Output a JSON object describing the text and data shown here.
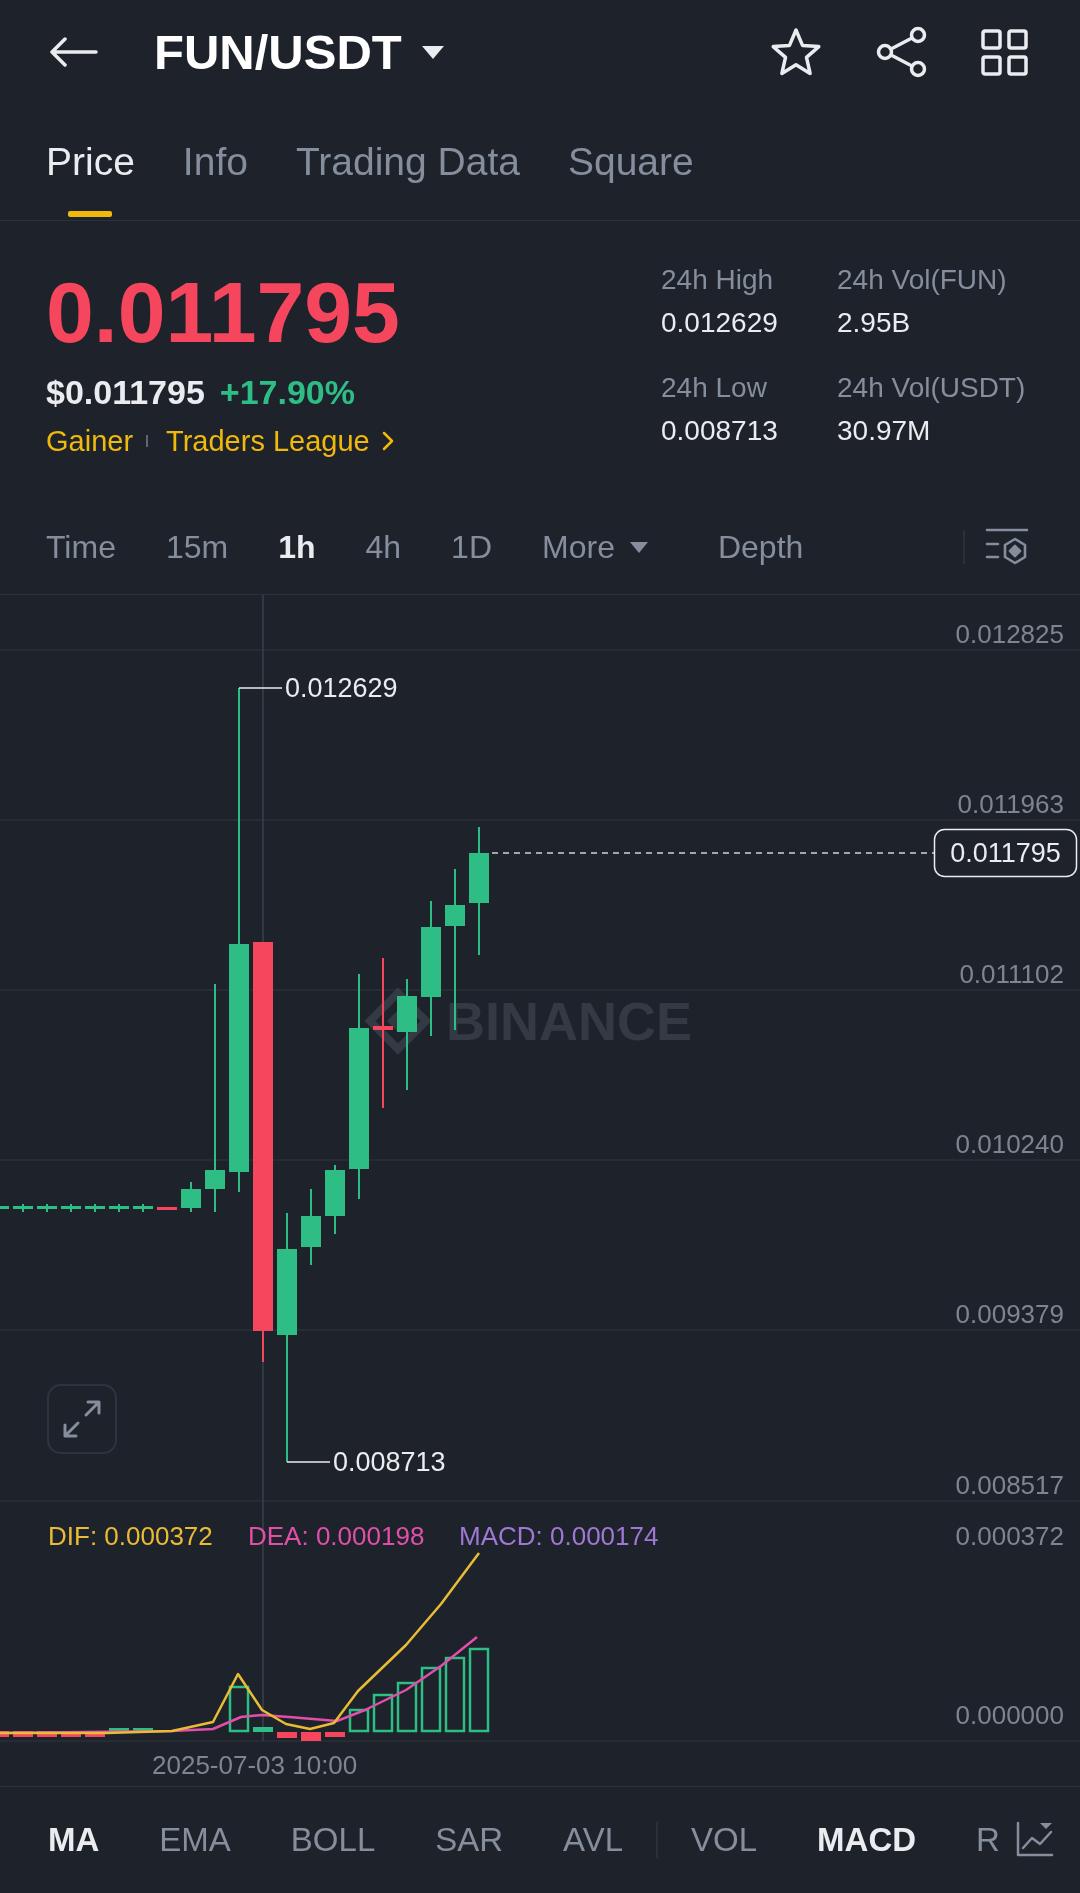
{
  "header": {
    "title": "FUN/USDT"
  },
  "tabs": [
    {
      "label": "Price",
      "selected": true
    },
    {
      "label": "Info",
      "selected": false
    },
    {
      "label": "Trading Data",
      "selected": false
    },
    {
      "label": "Square",
      "selected": false
    }
  ],
  "ticker": {
    "price": {
      "value": "0.011795",
      "rising": false
    },
    "fiat_price": "$0.011795",
    "change": {
      "value": "+17.90%",
      "rising": true
    },
    "tags": [
      {
        "label": "Gainer",
        "kind": "tag"
      },
      {
        "label": "Traders League",
        "kind": "link"
      }
    ],
    "stats": [
      {
        "label": "24h High",
        "value": "0.012629"
      },
      {
        "label": "24h Vol(FUN)",
        "value": "2.95B"
      },
      {
        "label": "24h Low",
        "value": "0.008713"
      },
      {
        "label": "24h Vol(USDT)",
        "value": "30.97M"
      }
    ]
  },
  "intervals": [
    {
      "label": "Time",
      "kind": "interval",
      "selected": false
    },
    {
      "label": "15m",
      "kind": "interval",
      "selected": false
    },
    {
      "label": "1h",
      "kind": "interval",
      "selected": true
    },
    {
      "label": "4h",
      "kind": "interval",
      "selected": false
    },
    {
      "label": "1D",
      "kind": "interval",
      "selected": false
    },
    {
      "label": "More",
      "kind": "dropdown",
      "selected": false
    },
    {
      "label": "Depth",
      "kind": "view",
      "selected": false
    }
  ],
  "chart": {
    "watermark": "BINANCE",
    "price_axis": [
      "0.012825",
      "0.011963",
      "0.011102",
      "0.010240",
      "0.009379",
      "0.008517"
    ],
    "high_label": "0.012629",
    "low_label": "0.008713",
    "last_price": "0.011795"
  },
  "macd": {
    "legend": [
      {
        "label": "DIF: 0.000372",
        "color": "#e8bc34"
      },
      {
        "label": "DEA: 0.000198",
        "color": "#e04fa8"
      },
      {
        "label": "MACD: 0.000174",
        "color": "#9f78d6"
      }
    ],
    "axis": [
      "0.000372",
      "0.000000"
    ],
    "time_label": "2025-07-03 10:00"
  },
  "indicators": {
    "main": [
      {
        "label": "MA",
        "selected": true
      },
      {
        "label": "EMA",
        "selected": false
      },
      {
        "label": "BOLL",
        "selected": false
      },
      {
        "label": "SAR",
        "selected": false
      },
      {
        "label": "AVL",
        "selected": false
      }
    ],
    "sub": [
      {
        "label": "VOL",
        "selected": false
      },
      {
        "label": "MACD",
        "selected": true
      },
      {
        "label": "R",
        "selected": false
      }
    ]
  }
}
